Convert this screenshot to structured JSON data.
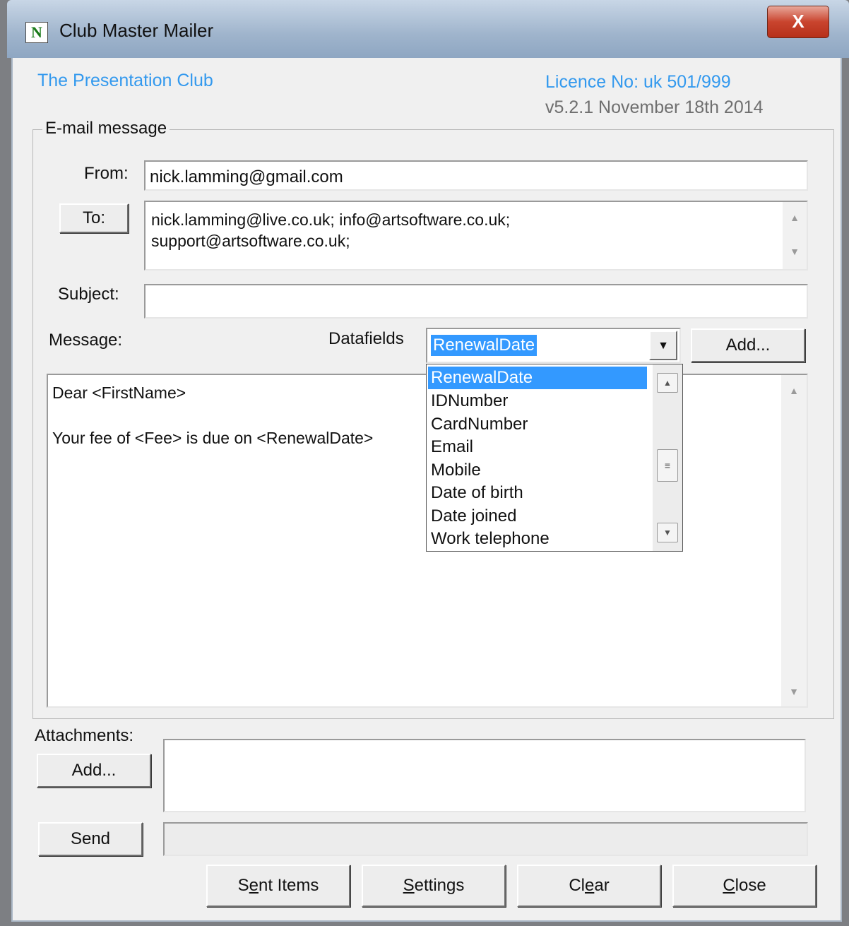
{
  "window": {
    "title": "Club Master Mailer",
    "icon_letter": "N",
    "close_glyph": "X"
  },
  "header": {
    "club_name": "The Presentation Club",
    "licence": "Licence No:  uk 501/999",
    "version": "v5.2.1 November 18th 2014"
  },
  "email": {
    "group_label": "E-mail message",
    "from_label": "From:",
    "from_value": "nick.lamming@gmail.com",
    "to_button": "To:",
    "to_line1": "nick.lamming@live.co.uk; info@artsoftware.co.uk;",
    "to_line2": "support@artsoftware.co.uk;",
    "subject_label": "Subject:",
    "subject_value": "",
    "message_label": "Message:",
    "datafields_label": "Datafields",
    "datafields_selected": "RenewalDate",
    "datafields_options": [
      "RenewalDate",
      "IDNumber",
      "CardNumber",
      "Email",
      "Mobile",
      "Date of birth",
      "Date joined",
      "Work telephone"
    ],
    "add_field_button": "Add...",
    "message_line1": "Dear <FirstName>",
    "message_line2": "Your fee of <Fee> is due on <RenewalDate>"
  },
  "attachments": {
    "label": "Attachments:",
    "add_button": "Add..."
  },
  "send": {
    "button": "Send",
    "status": ""
  },
  "footer": {
    "sent_items": {
      "pre": "S",
      "ul": "e",
      "post": "nt Items"
    },
    "settings": {
      "pre": "",
      "ul": "S",
      "post": "ettings"
    },
    "clear": {
      "pre": "Cl",
      "ul": "e",
      "post": "ar"
    },
    "close": {
      "pre": "",
      "ul": "C",
      "post": "lose"
    }
  },
  "colors": {
    "accent_blue": "#3399ee",
    "selection": "#3399ff",
    "close_red": "#c9442e"
  }
}
